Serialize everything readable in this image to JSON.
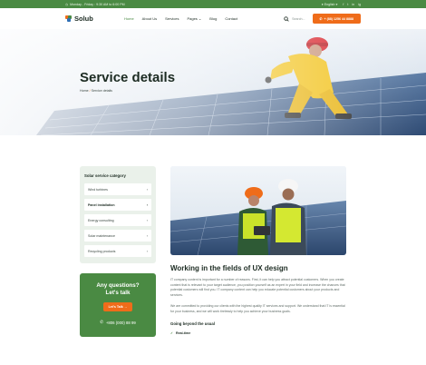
{
  "topbar": {
    "hours": "Monday - Friday : 9:30 AM to 6:00 PM",
    "language": "English",
    "social": [
      "f",
      "t",
      "in",
      "ig"
    ]
  },
  "header": {
    "logo_text": "Solub",
    "nav": [
      {
        "label": "Home",
        "active": true
      },
      {
        "label": "About Us",
        "active": false
      },
      {
        "label": "Services",
        "active": false
      },
      {
        "label": "Pages",
        "active": false
      },
      {
        "label": "Blog",
        "active": false
      },
      {
        "label": "Contact",
        "active": false
      }
    ],
    "search_label": "Search...",
    "cta_label": "+ (88) 1256 44 8888"
  },
  "hero": {
    "title": "Service details",
    "crumb_home": "Home",
    "crumb_sep": "/",
    "crumb_current": "Service details"
  },
  "sidebar": {
    "category_title": "Solar service category",
    "items": [
      {
        "label": "Wind turbines",
        "active": false
      },
      {
        "label": "Panel installation",
        "active": true
      },
      {
        "label": "Energy consulting",
        "active": false
      },
      {
        "label": "Solar maintenance",
        "active": false
      },
      {
        "label": "Recycling products",
        "active": false
      }
    ],
    "question_title_1": "Any questions?",
    "question_title_2": "Let's talk",
    "question_button": "Let's Talk",
    "phone": "+806 (000) 88 99"
  },
  "main": {
    "heading": "Working in the fields of UX design",
    "para_1": "IT company content is important for a number of reasons. First, it can help you attract potential customers. When you create content that is relevant to your target audience, you position yourself as an expert in your field and increase the chances that potential customers will find you. IT company content can help you educate potential customers about your products and services.",
    "para_2": "We are committed to providing our clients with the highest quality IT services and support. We understand that IT is essential for your business, and we will work tirelessly to help you achieve your business goals.",
    "sub_heading": "Going beyond the usual",
    "bullet_1": "Real-time"
  },
  "colors": {
    "brand_green": "#4a8a43",
    "accent_orange": "#ef6c1a",
    "dark_text": "#1c2b22"
  }
}
